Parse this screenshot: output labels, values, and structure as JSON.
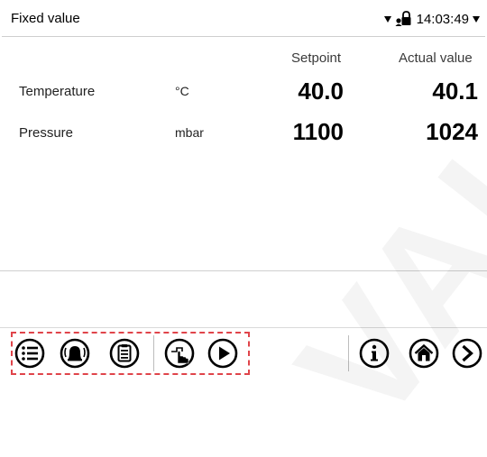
{
  "header": {
    "title": "Fixed value",
    "time": "14:03:49"
  },
  "table": {
    "columns": {
      "setpoint": "Setpoint",
      "actual": "Actual value"
    },
    "rows": [
      {
        "label": "Temperature",
        "unit": "°C",
        "setpoint": "40.0",
        "actual": "40.1"
      },
      {
        "label": "Pressure",
        "unit": "mbar",
        "setpoint": "1100",
        "actual": "1024"
      }
    ]
  },
  "toolbar": {
    "left_icons": [
      "menu-list-icon",
      "alarm-bell-icon",
      "clipboard-icon",
      "manual-hand-icon",
      "play-icon"
    ],
    "right_icons": [
      "info-icon",
      "home-icon",
      "next-arrow-icon"
    ],
    "highlight_color": "#e0444a"
  },
  "watermark": "VALUE DE"
}
